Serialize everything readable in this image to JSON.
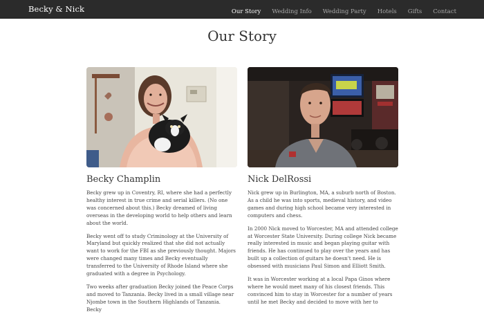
{
  "navbar": {
    "brand": "Becky & Nick",
    "items": [
      {
        "label": "Our Story",
        "active": true
      },
      {
        "label": "Wedding Info",
        "active": false
      },
      {
        "label": "Wedding Party",
        "active": false
      },
      {
        "label": "Hotels",
        "active": false
      },
      {
        "label": "Gifts",
        "active": false
      },
      {
        "label": "Contact",
        "active": false
      }
    ]
  },
  "page": {
    "title": "Our Story"
  },
  "people": [
    {
      "name": "Becky Champlin",
      "paragraphs": [
        "Becky grew up in Coventry, RI, where she had a perfectly healthy interest in true crime and serial killers. (No one was concerned about this.) Becky dreamed of living overseas in the developing world to help others and learn about the world.",
        "Becky went off to study Criminology at the University of Maryland but quickly realized that she did not actually want to work for the FBI as she previously thought. Majors were changed many times and Becky eventually transferred to the University of Rhode Island where she graduated with a degree in Psychology.",
        "Two weeks after graduation Becky joined the Peace Corps and moved to Tanzania. Becky lived in a small village near Njombe town in the Southern Highlands of Tanzania. Becky"
      ]
    },
    {
      "name": "Nick DelRossi",
      "paragraphs": [
        "Nick grew up in Burlington, MA, a suburb north of Boston. As a child he was into sports, medieval history, and video games and during high school became very interested in computers and chess.",
        "In 2000 Nick moved to Worcester, MA and attended college at Worcester State University. During college Nick became really interested in music and began playing guitar with friends. He has continued to play over the years and has built up a collection of guitars he doesn't need. He is obsessed with musicians Paul Simon and Elliott Smith.",
        "It was in Worcester working at a local Papa Ginos where where he would meet many of his closest friends. This convinced him to stay in Worcester for a number of years until he met Becky and decided to move with her to"
      ]
    }
  ]
}
